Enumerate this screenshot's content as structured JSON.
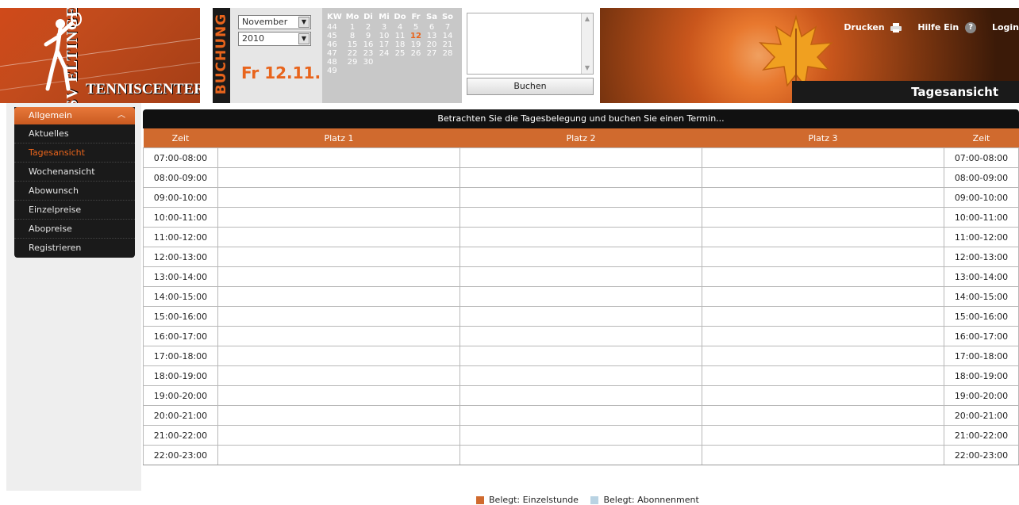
{
  "brand": {
    "logo_text": "TSV ELTINGEN",
    "center_name": "TENNISCENTER"
  },
  "buchung_label": "BUCHUNG",
  "date_select": {
    "month": "November",
    "year": "2010",
    "current_date": "Fr 12.11."
  },
  "calendar": {
    "headers": [
      "KW",
      "Mo",
      "Di",
      "Mi",
      "Do",
      "Fr",
      "Sa",
      "So"
    ],
    "weeks": [
      {
        "kw": "44",
        "days": [
          "1",
          "2",
          "3",
          "4",
          "5",
          "6",
          "7"
        ]
      },
      {
        "kw": "45",
        "days": [
          "8",
          "9",
          "10",
          "11",
          "12",
          "13",
          "14"
        ]
      },
      {
        "kw": "46",
        "days": [
          "15",
          "16",
          "17",
          "18",
          "19",
          "20",
          "21"
        ]
      },
      {
        "kw": "47",
        "days": [
          "22",
          "23",
          "24",
          "25",
          "26",
          "27",
          "28"
        ]
      },
      {
        "kw": "48",
        "days": [
          "29",
          "30",
          "",
          "",
          "",
          "",
          ""
        ]
      },
      {
        "kw": "49",
        "days": [
          "",
          "",
          "",
          "",
          "",
          "",
          ""
        ]
      }
    ],
    "today": "12"
  },
  "booking": {
    "button_label": "Buchen"
  },
  "toolbar": {
    "print_label": "Drucken",
    "help_label": "Hilfe Ein",
    "login_label": "Login"
  },
  "view_title": "Tagesansicht",
  "nav": {
    "section_label": "Allgemein",
    "items": [
      {
        "label": "Aktuelles",
        "active": false
      },
      {
        "label": "Tagesansicht",
        "active": true
      },
      {
        "label": "Wochenansicht",
        "active": false
      },
      {
        "label": "Abowunsch",
        "active": false
      },
      {
        "label": "Einzelpreise",
        "active": false
      },
      {
        "label": "Abopreise",
        "active": false
      },
      {
        "label": "Registrieren",
        "active": false
      }
    ]
  },
  "main": {
    "instruction": "Betrachten Sie die Tagesbelegung und buchen Sie einen Termin...",
    "columns": [
      "Zeit",
      "Platz 1",
      "Platz 2",
      "Platz 3",
      "Zeit"
    ],
    "time_slots": [
      "07:00-08:00",
      "08:00-09:00",
      "09:00-10:00",
      "10:00-11:00",
      "11:00-12:00",
      "12:00-13:00",
      "13:00-14:00",
      "14:00-15:00",
      "15:00-16:00",
      "16:00-17:00",
      "17:00-18:00",
      "18:00-19:00",
      "19:00-20:00",
      "20:00-21:00",
      "21:00-22:00",
      "22:00-23:00"
    ]
  },
  "legend": {
    "items": [
      {
        "label": "Belegt: Einzelstunde",
        "color": "#d06a2e"
      },
      {
        "label": "Belegt: Abonnenment",
        "color": "#b9d3e3"
      }
    ]
  },
  "colors": {
    "accent": "#e8641c",
    "header_bar": "#d06a2e",
    "dark": "#1a1a1a"
  }
}
